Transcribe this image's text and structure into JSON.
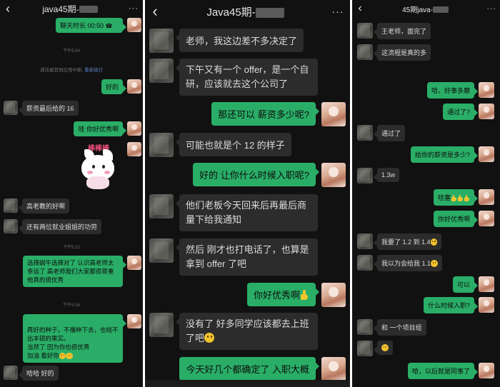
{
  "panels": [
    {
      "title": "java45期-",
      "back": "‹",
      "more": "···",
      "messages": [
        {
          "kind": "out",
          "text": "聊天时长 00:50",
          "call_icon": "phone-hangup-icon"
        },
        {
          "kind": "time",
          "text": "下午5:04"
        },
        {
          "kind": "sys",
          "text": "通话被其他应用中断,",
          "link": "重新拨打"
        },
        {
          "kind": "out",
          "text": "好的"
        },
        {
          "kind": "in",
          "text": "薪资最后给的 16"
        },
        {
          "kind": "out",
          "text": "哇  你好优秀啊"
        },
        {
          "kind": "sticker",
          "text": "棒棒棒",
          "name": "cat-sticker"
        },
        {
          "kind": "in",
          "text": "高老教的好啊"
        },
        {
          "kind": "in",
          "text": "还有两位就业姐姐的功劳"
        },
        {
          "kind": "time",
          "text": "下午5:12"
        },
        {
          "kind": "out",
          "text": "选择蜗牛选择对了 认识高老师太幸运了  高老师我们大家都很尊重 他真的很优秀"
        },
        {
          "kind": "time",
          "text": "下午5:16"
        },
        {
          "kind": "out",
          "text": "再好的种子，不播种下去，也结不出丰硕的果实。\n当然了 因为你也很优秀\n加油  看好你",
          "emojis": [
            "clap-emoji-icon",
            "smile-emoji-icon"
          ]
        },
        {
          "kind": "in",
          "text": "哈哈  好的"
        }
      ]
    },
    {
      "title": "Java45期-",
      "back": "‹",
      "more": "···",
      "messages": [
        {
          "kind": "in",
          "text": "老师，我这边差不多决定了"
        },
        {
          "kind": "in",
          "text": "下午又有一个 offer，是一个自研，应该就去这个公司了"
        },
        {
          "kind": "out",
          "text": "那还可以  薪资多少呢?"
        },
        {
          "kind": "in",
          "text": "可能也就是个 12 的样子"
        },
        {
          "kind": "out",
          "text": "好的  让你什么时候入职呢?"
        },
        {
          "kind": "in",
          "text": "他们老板今天回来后再最后商量下给我通知"
        },
        {
          "kind": "in",
          "text": "然后    刚才也打电话了，也算是拿到 offer 了吧"
        },
        {
          "kind": "out",
          "text": "你好优秀啊",
          "emojis": [
            "thumbs-up-icon"
          ]
        },
        {
          "kind": "in",
          "text": "没有了  好多同学应该都去上班了吧",
          "emojis": [
            "laugh-emoji-icon"
          ]
        },
        {
          "kind": "out",
          "text": "今天好几个都确定了 入职大概"
        }
      ]
    },
    {
      "title": "45期java-",
      "back": "‹",
      "more": "···",
      "messages": [
        {
          "kind": "in",
          "text": "王老师，面完了"
        },
        {
          "kind": "in",
          "text": "这流程是真的多"
        },
        {
          "kind": "out",
          "text": "哈，好事多磨"
        },
        {
          "kind": "out",
          "text": "通过了?"
        },
        {
          "kind": "in",
          "text": "通过了"
        },
        {
          "kind": "out",
          "text": "给你的薪资是多少?"
        },
        {
          "kind": "in",
          "text": "1.3w"
        },
        {
          "kind": "out",
          "text": "哇塞",
          "emojis": [
            "thumbs-up-icon",
            "thumbs-up-icon",
            "thumbs-up-icon"
          ]
        },
        {
          "kind": "out",
          "text": "你好优秀啊"
        },
        {
          "kind": "in",
          "text": "我要了 1.2 到 1.4",
          "emojis": [
            "laugh-emoji-icon"
          ]
        },
        {
          "kind": "in",
          "text": "我以为会给我 1.1",
          "emojis": [
            "laugh-emoji-icon"
          ]
        },
        {
          "kind": "out",
          "text": "可以"
        },
        {
          "kind": "out",
          "text": "什么时候入职?"
        },
        {
          "kind": "in",
          "text": "和    一个项目组"
        },
        {
          "kind": "in",
          "text": "",
          "emojis": [
            "laugh-emoji-icon"
          ]
        },
        {
          "kind": "out",
          "text": "哈，以后就是同事了"
        }
      ]
    }
  ]
}
